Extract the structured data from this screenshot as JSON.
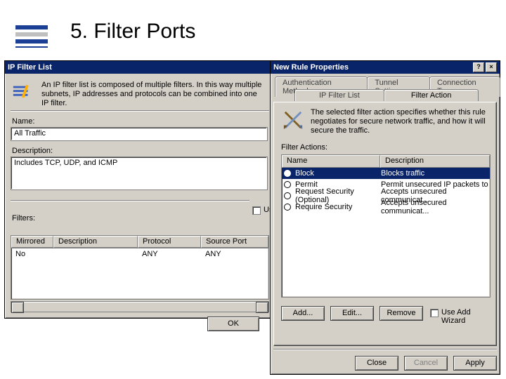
{
  "slide": {
    "title": "5. Filter Ports"
  },
  "ipfilt": {
    "window_title": "IP Filter List",
    "intro": "An IP filter list is composed of multiple filters. In this way multiple subnets, IP addresses and protocols can be combined into one IP filter.",
    "name_label": "Name:",
    "name_value": "All Traffic",
    "desc_label": "Description:",
    "desc_value": "Includes TCP, UDP, and ICMP",
    "filters_label": "Filters:",
    "use_add_suffix": "Us",
    "cols": {
      "mirrored": "Mirrored",
      "description": "Description",
      "protocol": "Protocol",
      "source_port": "Source Port"
    },
    "row": {
      "mirrored": "No",
      "description": "",
      "protocol": "ANY",
      "source_port": "ANY"
    },
    "ok": "OK"
  },
  "rule": {
    "window_title": "New Rule Properties",
    "help_glyph": "?",
    "close_glyph": "×",
    "tabs_row1": {
      "auth": "Authentication Methods",
      "tunnel": "Tunnel Setting",
      "conn": "Connection Type"
    },
    "tabs_row2": {
      "iplist": "IP Filter List",
      "action": "Filter Action"
    },
    "intro": "The selected filter action specifies whether this rule negotiates for secure network traffic, and how it will secure the traffic.",
    "fa_label": "Filter Actions:",
    "cols": {
      "name": "Name",
      "desc": "Description"
    },
    "rows": [
      {
        "name": "Block",
        "desc": "Blocks traffic",
        "selected": true
      },
      {
        "name": "Permit",
        "desc": "Permit unsecured IP packets to",
        "selected": false
      },
      {
        "name": "Request Security (Optional)",
        "desc": "Accepts unsecured communicat...",
        "selected": false
      },
      {
        "name": "Require Security",
        "desc": "Accepts unsecured communicat...",
        "selected": false
      }
    ],
    "add": "Add...",
    "edit": "Edit...",
    "remove": "Remove",
    "use_wizard": "Use Add Wizard",
    "close": "Close",
    "cancel": "Cancel",
    "apply": "Apply"
  }
}
